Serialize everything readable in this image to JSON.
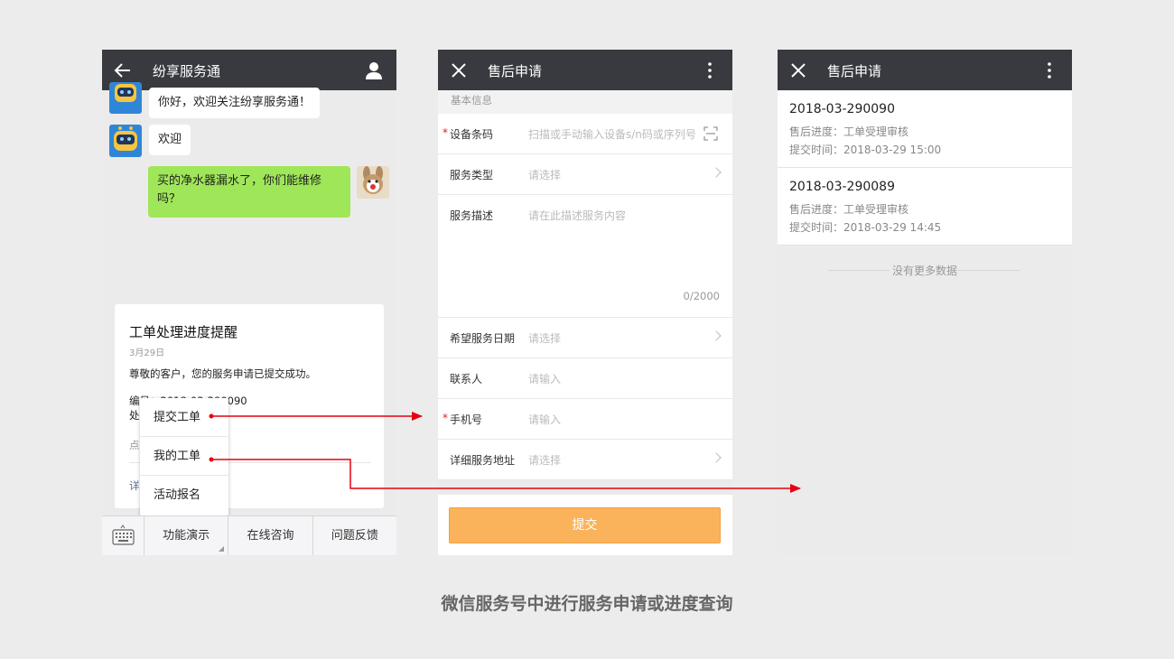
{
  "chat_screen": {
    "title": "纷享服务通",
    "back_icon": "back-arrow-icon",
    "profile_icon": "person-icon",
    "messages": [
      {
        "from": "bot",
        "text": "你好，欢迎关注纷享服务通！"
      },
      {
        "from": "bot",
        "text": "欢迎"
      },
      {
        "from": "user",
        "text": "买的净水器漏水了，你们能维修吗？"
      }
    ],
    "card": {
      "title": "工单处理进度提醒",
      "date": "3月29日",
      "text": "尊敬的客户，您的服务申请已提交成功。",
      "line1": "编号：2018-03-290090",
      "line2": "处",
      "gray_text": "点                                       度。",
      "link": "详"
    },
    "popup_menu": [
      "提交工单",
      "我的工单",
      "活动报名"
    ],
    "bottom_menu": [
      "功能演示",
      "在线咨询",
      "问题反馈"
    ]
  },
  "form_screen": {
    "title": "售后申请",
    "close_icon": "close-icon",
    "more_icon": "more-vertical-icon",
    "section": "基本信息",
    "fields": [
      {
        "label": "设备条码",
        "required": true,
        "placeholder": "扫描或手动输入设备s/n码或序列号",
        "icon": "scan-icon"
      },
      {
        "label": "服务类型",
        "required": false,
        "placeholder": "请选择",
        "icon": "chevron-right-icon"
      },
      {
        "label": "服务描述",
        "required": false,
        "placeholder": "请在此描述服务内容",
        "counter": "0/2000"
      },
      {
        "label": "希望服务日期",
        "required": false,
        "placeholder": "请选择",
        "icon": "chevron-right-icon"
      },
      {
        "label": "联系人",
        "required": false,
        "placeholder": "请输入"
      },
      {
        "label": "手机号",
        "required": true,
        "placeholder": "请输入"
      },
      {
        "label": "详细服务地址",
        "required": false,
        "placeholder": "请选择",
        "icon": "chevron-right-icon"
      }
    ],
    "required_mark": "*",
    "submit_label": "提交",
    "submit_color": "#fbb35b"
  },
  "list_screen": {
    "title": "售后申请",
    "items": [
      {
        "number": "2018-03-290090",
        "progress": "售后进度：工单受理审核",
        "time": "提交时间：2018-03-29 15:00"
      },
      {
        "number": "2018-03-290089",
        "progress": "售后进度：工单受理审核",
        "time": "提交时间：2018-03-29 14:45"
      }
    ],
    "no_more": "没有更多数据"
  },
  "caption": "微信服务号中进行服务申请或进度查询",
  "colors": {
    "topbar": "#393a3f",
    "arrow": "#e60012",
    "chat_green": "#9fe658"
  }
}
